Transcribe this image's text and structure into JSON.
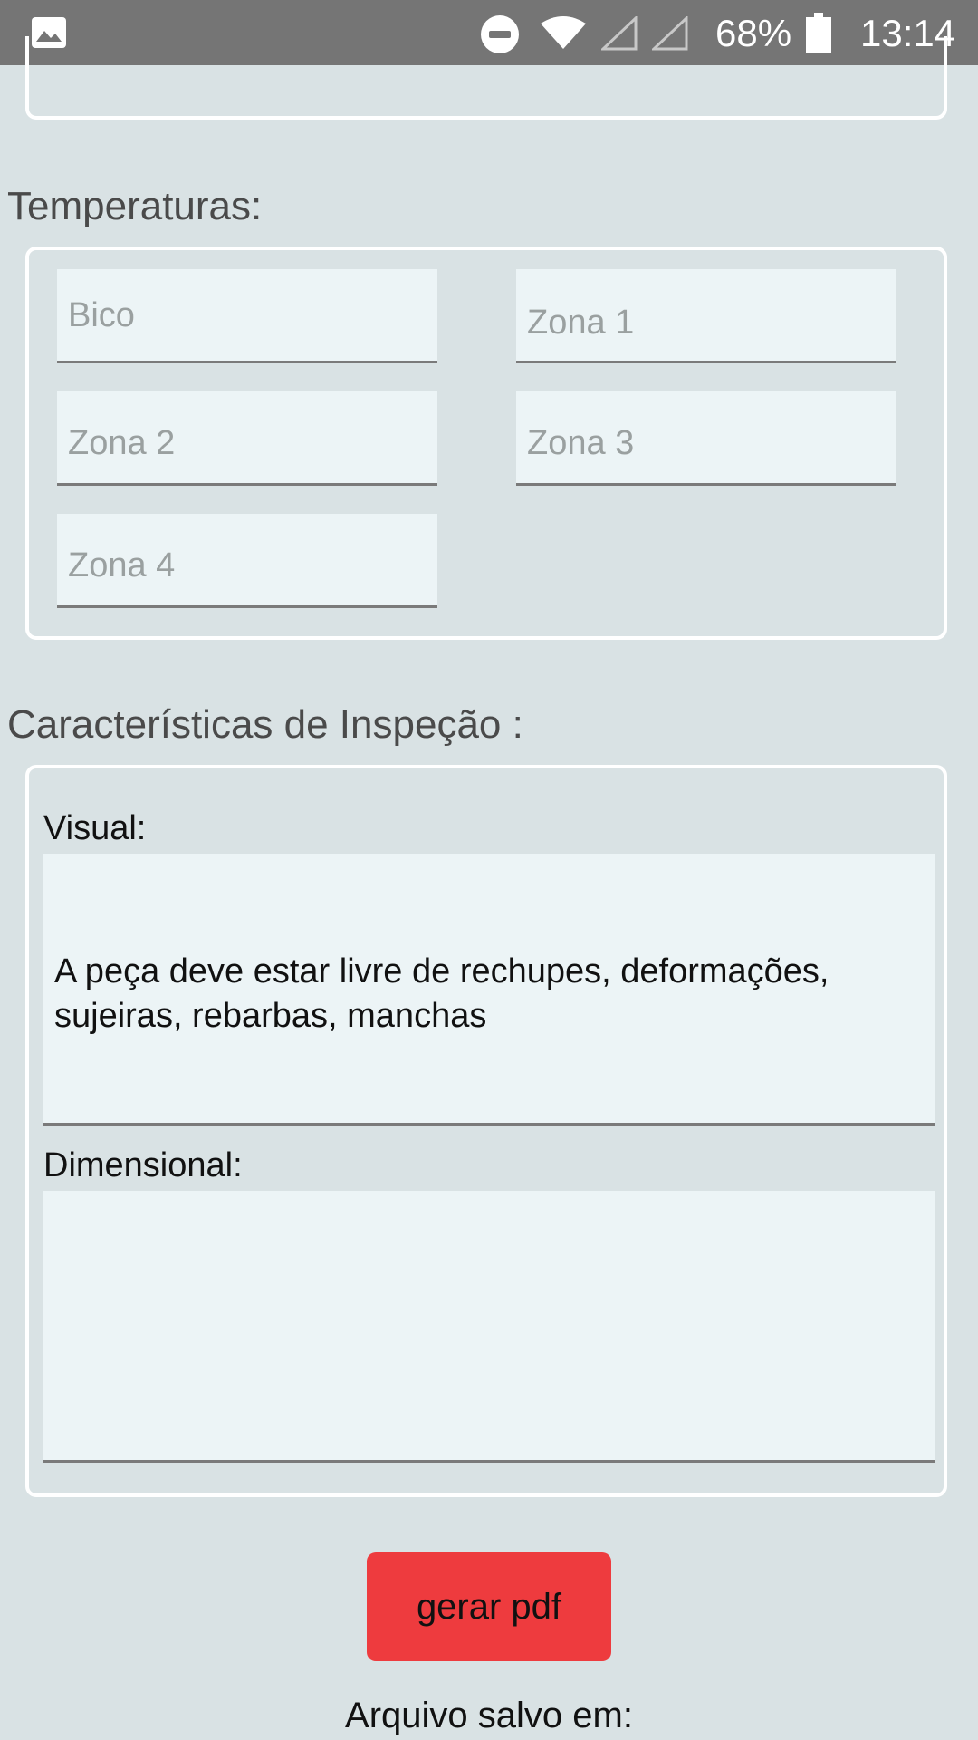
{
  "status_bar": {
    "battery_text": "68%",
    "time": "13:14",
    "icons": [
      "gallery-icon",
      "do-not-disturb-icon",
      "wifi-icon",
      "signal-icon",
      "signal-icon",
      "battery-icon"
    ]
  },
  "temperatures": {
    "title": "Temperaturas:",
    "fields": [
      {
        "placeholder": "Bico",
        "value": ""
      },
      {
        "placeholder": "Zona 1",
        "value": ""
      },
      {
        "placeholder": "Zona 2",
        "value": ""
      },
      {
        "placeholder": "Zona 3",
        "value": ""
      },
      {
        "placeholder": "Zona 4",
        "value": ""
      }
    ]
  },
  "inspection": {
    "title": "Características de Inspeção :",
    "visual_label": "Visual:",
    "visual_value": "A peça deve estar livre de rechupes, deformações, sujeiras, rebarbas, manchas",
    "dimensional_label": "Dimensional:",
    "dimensional_value": ""
  },
  "actions": {
    "generate_pdf_label": "gerar pdf",
    "saved_text": "Arquivo salvo em:"
  },
  "colors": {
    "background": "#d9e2e4",
    "status_bar": "#757575",
    "button": "#ee3b3e",
    "field_bg": "#ecf4f6"
  }
}
